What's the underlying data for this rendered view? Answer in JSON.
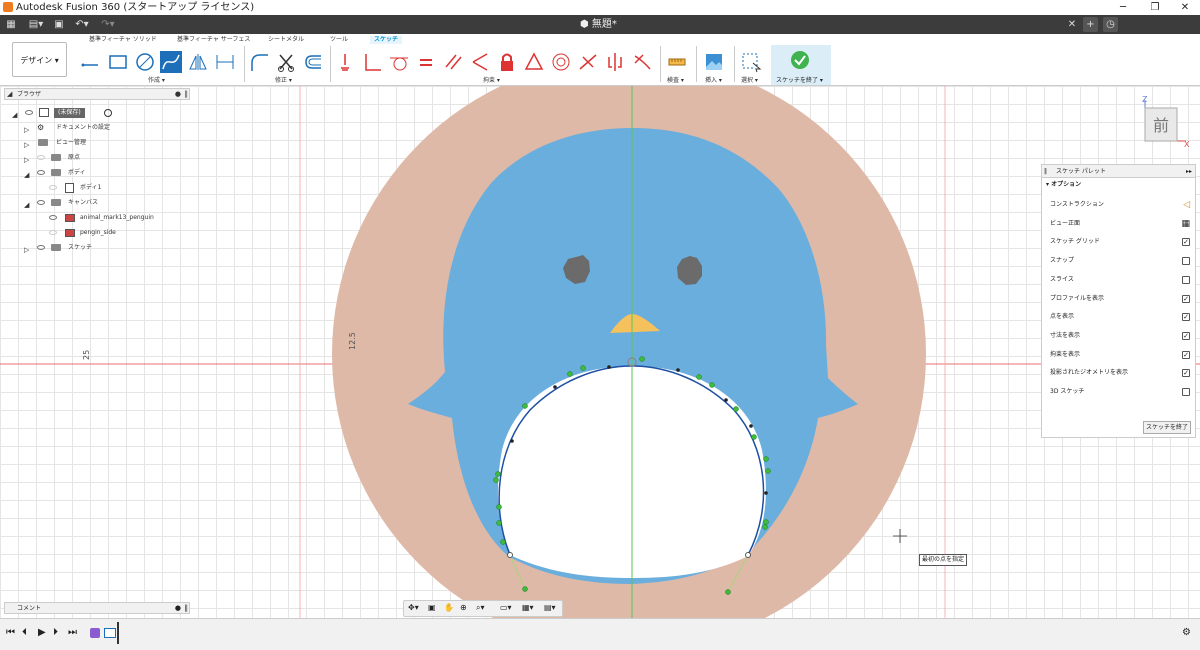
{
  "window": {
    "title": "Autodesk Fusion 360 (スタートアップ ライセンス)"
  },
  "document": {
    "tab_name": "無題*"
  },
  "workspace": {
    "label": "デザイン ▾"
  },
  "tabs": [
    "基準フィーチャ ソリッド",
    "基準フィーチャ サーフェス",
    "シートメタル",
    "ツール",
    "スケッチ"
  ],
  "tool_groups": {
    "create": "作成 ▾",
    "modify": "修正 ▾",
    "constraints": "拘束 ▾",
    "inspect": "検査 ▾",
    "insert": "挿入 ▾",
    "select": "選択 ▾",
    "finish": "スケッチを終了 ▾"
  },
  "browser": {
    "title": "ブラウザ",
    "items": [
      "(未保存)",
      "ドキュメントの設定",
      "ビュー管理",
      "原点",
      "ボディ",
      "ボディ1",
      "キャンバス",
      "animal_mark13_penguin",
      "pengin_side",
      "スケッチ"
    ]
  },
  "comments": {
    "title": "コメント"
  },
  "palette": {
    "title": "スケッチ パレット",
    "section": "▾ オプション",
    "finish_label": "スケッチを終了",
    "rows": [
      {
        "label": "コンストラクション",
        "icon": "construction-icon",
        "checked": false
      },
      {
        "label": "ビュー正面",
        "icon": "look-at-icon",
        "checked": false
      },
      {
        "label": "スケッチ グリッド",
        "checked": true
      },
      {
        "label": "スナップ",
        "checked": false
      },
      {
        "label": "スライス",
        "checked": false
      },
      {
        "label": "プロファイルを表示",
        "checked": true
      },
      {
        "label": "点を表示",
        "checked": true
      },
      {
        "label": "寸法を表示",
        "checked": true
      },
      {
        "label": "拘束を表示",
        "checked": true
      },
      {
        "label": "投影されたジオメトリを表示",
        "checked": true
      },
      {
        "label": "3D スケッチ",
        "checked": false
      }
    ]
  },
  "viewcube": {
    "face": "前",
    "z_label": "Z",
    "x_label": "X"
  },
  "dimensions": {
    "vertical": "12.5",
    "left_axis": "25"
  },
  "tooltip": "最初の点を指定",
  "colors": {
    "accent": "#0696d7",
    "circle": "#dfb9a7",
    "penguin": "#6aaedd",
    "beak": "#f5c15c",
    "eye": "#6b6b6b",
    "spline": "#1d4fa3",
    "point": "#3dbb3d"
  }
}
